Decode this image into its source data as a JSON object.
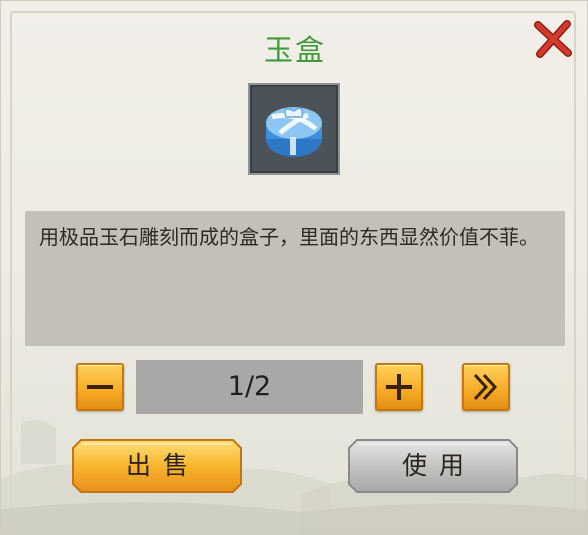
{
  "dialog": {
    "title": "玉盒",
    "item_icon": "jade-gift-box-icon",
    "description": "用极品玉石雕刻而成的盒子，里面的东西显然价值不菲。",
    "quantity": "1/2",
    "sell_label": "出售",
    "use_label": "使用"
  },
  "icons": {
    "close": "close-x-icon",
    "decrease": "minus-icon",
    "increase": "plus-icon",
    "max": "double-chevron-right-icon"
  },
  "colors": {
    "title": "#3f9a3a",
    "close": "#c8342a",
    "orange_button": "#f6a925",
    "gray_button": "#bdbdbb"
  }
}
